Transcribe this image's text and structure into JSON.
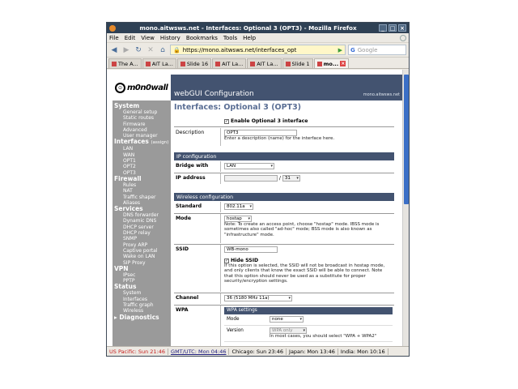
{
  "window": {
    "title": "mono.aitwsws.net - Interfaces: Optional 3 (OPT3) - Mozilla Firefox",
    "menu": [
      "File",
      "Edit",
      "View",
      "History",
      "Bookmarks",
      "Tools",
      "Help"
    ],
    "url": "https://mono.aitwsws.net/interfaces_opt",
    "search_placeholder": "Google",
    "tabs": [
      "The A...",
      "AIT La...",
      "Slide 16",
      "AIT La...",
      "AIT La...",
      "Slide 1",
      "mo..."
    ]
  },
  "banner": {
    "logo_text": "m0n0wall",
    "app_title": "webGUI Configuration",
    "host": "mono.aitwsws.net"
  },
  "sidebar": [
    {
      "section": "System",
      "items": [
        "General setup",
        "Static routes",
        "Firmware",
        "Advanced",
        "User manager"
      ]
    },
    {
      "section": "Interfaces",
      "section_sub": "(assign)",
      "items": [
        "LAN",
        "WAN",
        "OPT1",
        "OPT2",
        "OPT3"
      ]
    },
    {
      "section": "Firewall",
      "items": [
        "Rules",
        "NAT",
        "Traffic shaper",
        "Aliases"
      ]
    },
    {
      "section": "Services",
      "items": [
        "DNS forwarder",
        "Dynamic DNS",
        "DHCP server",
        "DHCP relay",
        "SNMP",
        "Proxy ARP",
        "Captive portal",
        "Wake on LAN",
        "SIP Proxy"
      ]
    },
    {
      "section": "VPN",
      "items": [
        "IPsec",
        "PPTP"
      ]
    },
    {
      "section": "Status",
      "items": [
        "System",
        "Interfaces",
        "Traffic graph",
        "Wireless"
      ]
    },
    {
      "section": "▸ Diagnostics",
      "items": []
    }
  ],
  "page": {
    "title": "Interfaces: Optional 3 (OPT3)",
    "enable_label": "Enable Optional 3 interface",
    "description_label": "Description",
    "description_value": "OPT3",
    "description_help": "Enter a description (name) for the interface here.",
    "ip_config_header": "IP configuration",
    "bridge_label": "Bridge with",
    "bridge_value": "LAN",
    "ip_label": "IP address",
    "ip_sep": "/",
    "ip_mask": "31",
    "wireless_header": "Wireless configuration",
    "standard_label": "Standard",
    "standard_value": "802.11a",
    "mode_label": "Mode",
    "mode_value": "hostap",
    "mode_note": "Note: To create an access point, choose \"hostap\" mode. IBSS mode is sometimes also called \"ad-hoc\" mode; BSS mode is also known as \"infrastructure\" mode.",
    "ssid_label": "SSID",
    "ssid_value": "WB-mono",
    "hide_ssid_label": "Hide SSID",
    "hide_ssid_note": "If this option is selected, the SSID will not be broadcast in hostap mode, and only clients that know the exact SSID will be able to connect. Note that this option should never be used as a substitute for proper security/encryption settings.",
    "channel_label": "Channel",
    "channel_value": "36 (5180 MHz 11a)",
    "wpa_label": "WPA",
    "wpa_settings_header": "WPA settings",
    "wpa_mode_label": "Mode",
    "wpa_mode_value": "none",
    "wpa_version_label": "Version",
    "wpa_version_value": "WPA only",
    "wpa_version_note": "In most cases, you should select \"WPA + WPA2\""
  },
  "statusbar": [
    "US Pacific: Sun 21:46",
    "GMT/UTC: Mon 04:46",
    "Chicago: Sun 23:46",
    "Japan: Mon 13:46",
    "India: Mon 10:16"
  ]
}
